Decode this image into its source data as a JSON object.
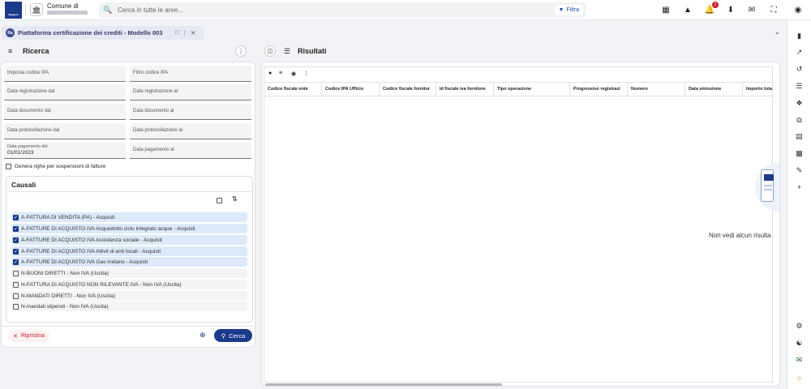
{
  "logo": {
    "text": "Maggioli"
  },
  "header": {
    "comune_label": "Comune di",
    "search_placeholder": "Cerca in tutte le aree...",
    "filtra_label": "Filtra",
    "notification_count": "1"
  },
  "tab": {
    "app_badge": "Ra",
    "title": "Piattaforma certificazione dei crediti - Modello 003"
  },
  "ricerca": {
    "title": "Ricerca",
    "fields": [
      {
        "label": "Imposta codice IPA",
        "value": ""
      },
      {
        "label": "Filtro codice IPA",
        "value": ""
      },
      {
        "label": "Data registrazione dal",
        "value": ""
      },
      {
        "label": "Data registrazione al",
        "value": ""
      },
      {
        "label": "Data documento dal",
        "value": ""
      },
      {
        "label": "Data documento al",
        "value": ""
      },
      {
        "label": "Data protocollazione dal",
        "value": ""
      },
      {
        "label": "Data protocollazione al",
        "value": ""
      },
      {
        "label": "Data pagamento dal",
        "value": "01/01/2023"
      },
      {
        "label": "Data pagamento al",
        "value": ""
      }
    ],
    "genera_label": "Genera righe per sospensioni di fatture",
    "causali_title": "Causali",
    "causali": [
      {
        "label": "A-FATTURA DI VENDITA (PA) - Acquisti",
        "checked": true
      },
      {
        "label": "A-FATTURE DI ACQUISTO IVA Acquedotto ciclo integrato acque - Acquisti",
        "checked": true
      },
      {
        "label": "A-FATTURE DI ACQUISTO IVA Assistenza sociale - Acquisti",
        "checked": true
      },
      {
        "label": "A-FATTURE DI ACQUISTO IVA Attivit di enti locali - Acquisti",
        "checked": true
      },
      {
        "label": "A-FATTURE DI ACQUISTO IVA Gas metano - Acquisti",
        "checked": true
      },
      {
        "label": "N-BUONI DIRETTI - Non IVA (Uscita)",
        "checked": false
      },
      {
        "label": "N-FATTURA DI ACQUISTO NON RILEVANTE IVA - Non IVA (Uscita)",
        "checked": false
      },
      {
        "label": "N-MANDATI DIRETTI - Non IVA (Uscita)",
        "checked": false
      },
      {
        "label": "N-mandati stipendi - Non IVA (Uscita)",
        "checked": false
      }
    ],
    "ripristina_label": "Ripristina",
    "cerca_label": "Cerca"
  },
  "risultati": {
    "title": "Risultati",
    "columns": [
      "Codice fiscale ente",
      "Codice IPA Ufficio",
      "Codice fiscale fornitor",
      "Id fiscale iva fornitore",
      "Tipo operazione",
      "Progressivo registrazi",
      "Numero",
      "Data emissione",
      "Importo tota"
    ],
    "empty_message": "Non vedi alcun risulta"
  },
  "colors": {
    "primary": "#1b3a8c",
    "selected_row": "#dce9f8",
    "danger": "#c0282d"
  },
  "icons": [
    "grid-icon",
    "warning-icon",
    "bell-icon",
    "download-icon",
    "mail-icon",
    "fullscreen-icon",
    "user-icon"
  ]
}
